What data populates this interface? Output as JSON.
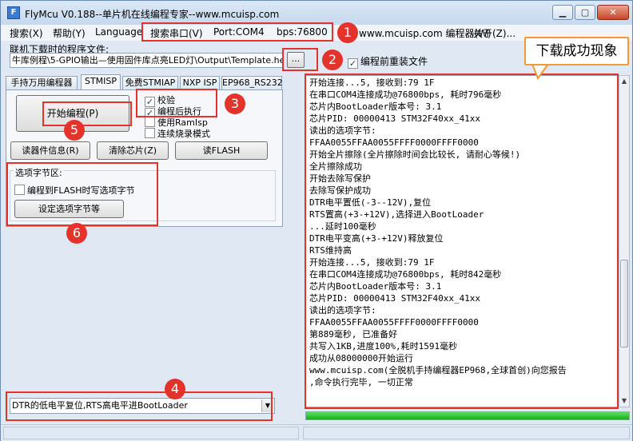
{
  "window": {
    "title": "FlyMcu V0.188--单片机在线编程专家--www.mcuisp.com",
    "minimize": "▁",
    "maximize": "▢",
    "close": "✕"
  },
  "menu": {
    "search": "搜索(X)",
    "help": "帮助(Y)",
    "language": "Language",
    "search_port": "搜索串口(V)",
    "port": "Port:COM4",
    "bps": "bps:76800",
    "site": "www.mcuisp.com 编程器(W)",
    "about": "关于(Z)..."
  },
  "file": {
    "label": "联机下载时的程序文件:",
    "path": "牛库例程\\5-GPIO输出—使用固件库点亮LED灯\\Output\\Template.hex",
    "browse": "...",
    "reload": "编程前重装文件",
    "reload_checked": "✓"
  },
  "tabs": [
    "手持万用编程器",
    "STMISP",
    "免费STMIAP",
    "NXP ISP",
    "EP968_RS232"
  ],
  "stmisp": {
    "start_button": "开始编程(P)",
    "options": [
      {
        "label": "校验",
        "mark": "✓"
      },
      {
        "label": "编程后执行",
        "mark": "✓"
      },
      {
        "label": "使用RamIsp",
        "mark": ""
      },
      {
        "label": "连续烧录模式",
        "mark": ""
      }
    ],
    "read_info": "读器件信息(R)",
    "erase_chip": "清除芯片(Z)",
    "read_flash": "读FLASH",
    "option_bytes_title": "选项字节区:",
    "write_option_bytes": "编程到FLASH时写选项字节",
    "set_option_bytes": "设定选项字节等"
  },
  "log_lines": [
    "开始连接...5, 接收到:79 1F",
    "在串口COM4连接成功@76800bps, 耗时796毫秒",
    "芯片内BootLoader版本号: 3.1",
    "芯片PID: 00000413  STM32F40xx_41xx",
    "读出的选项字节:",
    "FFAA0055FFAA0055FFFF0000FFFF0000",
    "开始全片擦除(全片擦除时间会比较长, 请耐心等候!)",
    "全片擦除成功",
    "开始去除写保护",
    "去除写保护成功",
    "DTR电平置低(-3--12V),复位",
    "RTS置高(+3-+12V),选择进入BootLoader",
    "...延时100毫秒",
    "DTR电平变高(+3-+12V)释放复位",
    "RTS维持高",
    "开始连接...5, 接收到:79 1F",
    "在串口COM4连接成功@76800bps, 耗时842毫秒",
    "芯片内BootLoader版本号: 3.1",
    "芯片PID: 00000413  STM32F40xx_41xx",
    "读出的选项字节:",
    "FFAA0055FFAA0055FFFF0000FFFF0000",
    "第889毫秒, 已准备好",
    "共写入1KB,进度100%,耗时1591毫秒",
    "成功从08000000开始运行",
    "www.mcuisp.com(全脱机手持编程器EP968,全球首创)向您报告",
    ",命令执行完毕, 一切正常"
  ],
  "scroll": {
    "up": "▲",
    "down": "▼"
  },
  "progress_percent": 100,
  "reset_mode": "DTR的低电平复位,RTS高电平进BootLoader",
  "combo_arrow": "▼",
  "callout": "下载成功现象",
  "badges": [
    "1",
    "2",
    "3",
    "4",
    "5",
    "6"
  ],
  "colors": {
    "annotation_red": "#e3332b",
    "callout_orange": "#f29b36",
    "progress_green": "#1fa71f"
  }
}
